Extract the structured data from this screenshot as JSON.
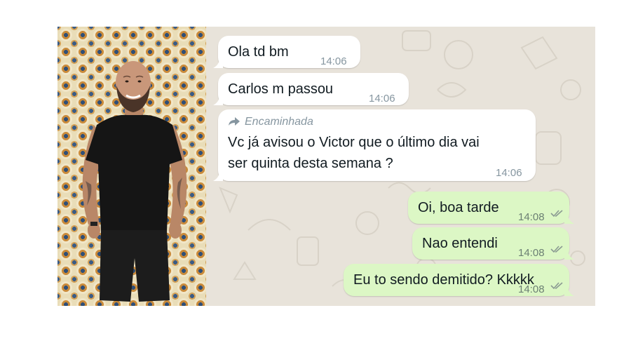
{
  "photo": {
    "icon": "person-photo"
  },
  "chat": {
    "messages": [
      {
        "direction": "incoming",
        "text": "Ola td bm",
        "time": "14:06"
      },
      {
        "direction": "incoming",
        "text": "Carlos m passou",
        "time": "14:06"
      },
      {
        "direction": "incoming",
        "forwarded_label": "Encaminhada",
        "text_line1": "Vc já avisou o Victor que o último dia vai",
        "text_line2": "ser quinta desta semana ?",
        "time": "14:06"
      },
      {
        "direction": "outgoing",
        "text": "Oi, boa tarde",
        "time": "14:08",
        "status": "read"
      },
      {
        "direction": "outgoing",
        "text": "Nao entendi",
        "time": "14:08",
        "status": "read"
      },
      {
        "direction": "outgoing",
        "text": "Eu to sendo demitido? Kkkkk",
        "time": "14:08",
        "status": "read"
      }
    ]
  },
  "colors": {
    "chat_background": "#e8e3da",
    "incoming_bubble": "#ffffff",
    "outgoing_bubble": "#dcf7c5",
    "timestamp": "#8696a0"
  }
}
